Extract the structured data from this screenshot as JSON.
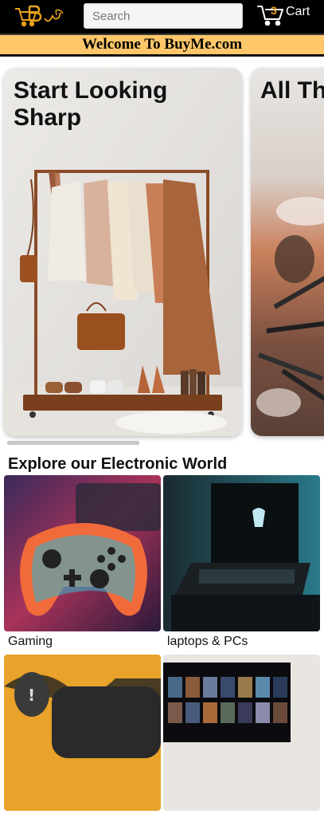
{
  "header": {
    "logo_text": "BuyMe",
    "search_placeholder": "Search",
    "cart_count": "3",
    "cart_label": "Cart"
  },
  "welcome": {
    "text": "Welcome To BuyMe.com"
  },
  "carousel": {
    "slides": [
      {
        "title": "Start Looking Sharp"
      },
      {
        "title": "All Th"
      }
    ]
  },
  "electronics": {
    "title": "Explore our Electronic World",
    "tiles": [
      {
        "label": "Gaming"
      },
      {
        "label": "laptops & PCs"
      },
      {
        "label": ""
      },
      {
        "label": ""
      }
    ]
  },
  "colors": {
    "header_bg": "#000000",
    "banner_bg": "#ffc76a",
    "accent": "#e9a21a"
  }
}
